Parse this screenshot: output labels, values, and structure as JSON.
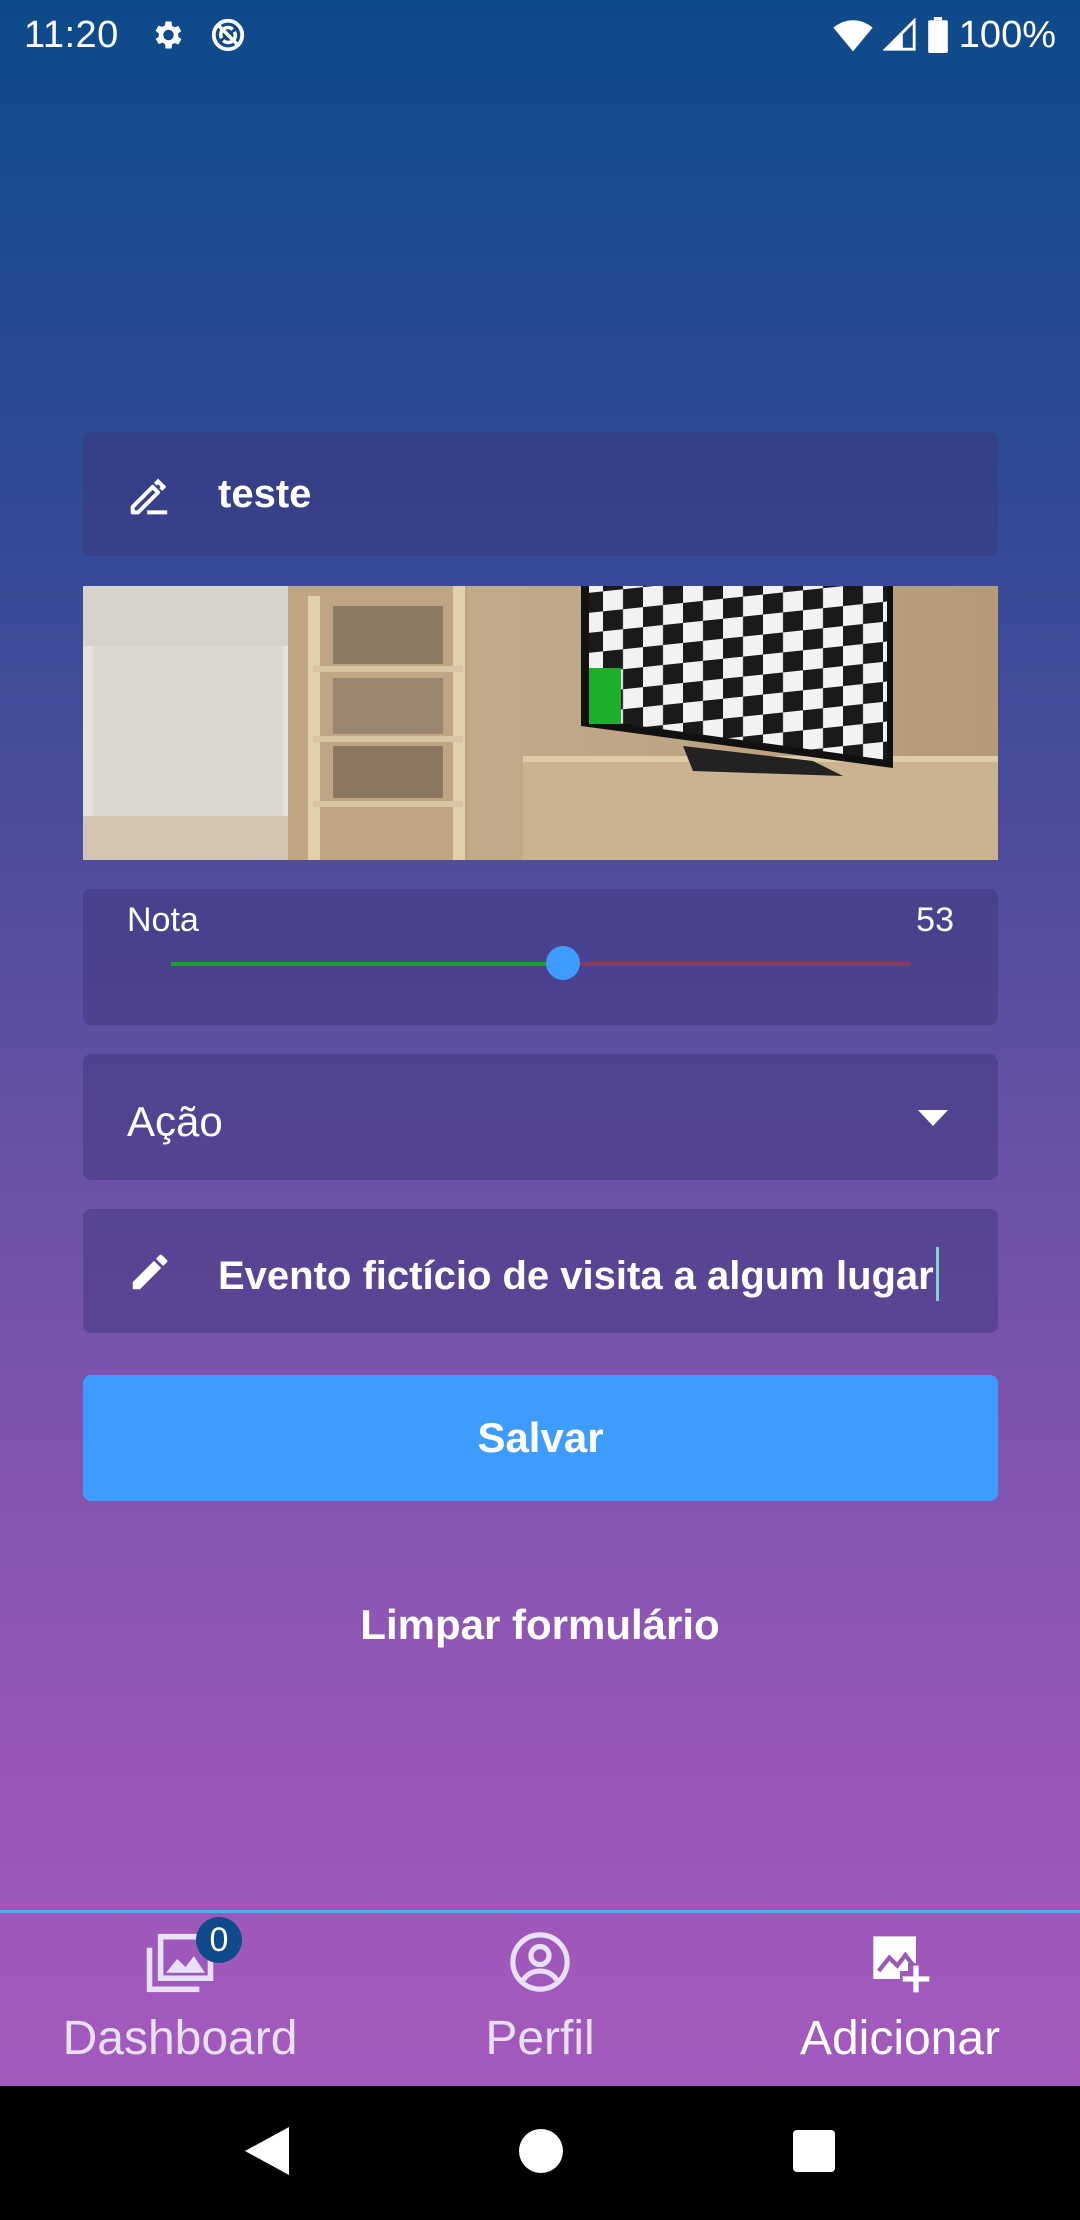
{
  "status_bar": {
    "time": "11:20",
    "battery": "100%",
    "icons": [
      "gear-icon",
      "sync-disabled-icon",
      "wifi-icon",
      "signal-icon",
      "battery-icon"
    ]
  },
  "form": {
    "title_value": "teste",
    "image_description": "photo",
    "rating": {
      "label": "Nota",
      "value": "53",
      "fraction": 0.53,
      "fill_color": "#1aa32a",
      "rest_color": "#8a3a5a",
      "thumb_color": "#3e9bff"
    },
    "category": {
      "selected": "Ação"
    },
    "description_value": "Evento fictício de visita a algum lugar",
    "save_label": "Salvar",
    "clear_label": "Limpar formulário"
  },
  "bottom_nav": {
    "items": [
      {
        "label": "Dashboard",
        "icon": "photo-library-icon",
        "badge": "0"
      },
      {
        "label": "Perfil",
        "icon": "account-circle-icon"
      },
      {
        "label": "Adicionar",
        "icon": "add-photo-icon"
      }
    ]
  },
  "colors": {
    "accent": "#3d9cff",
    "nav_border": "#4fb0f5",
    "badge": "#0f4a8a"
  }
}
